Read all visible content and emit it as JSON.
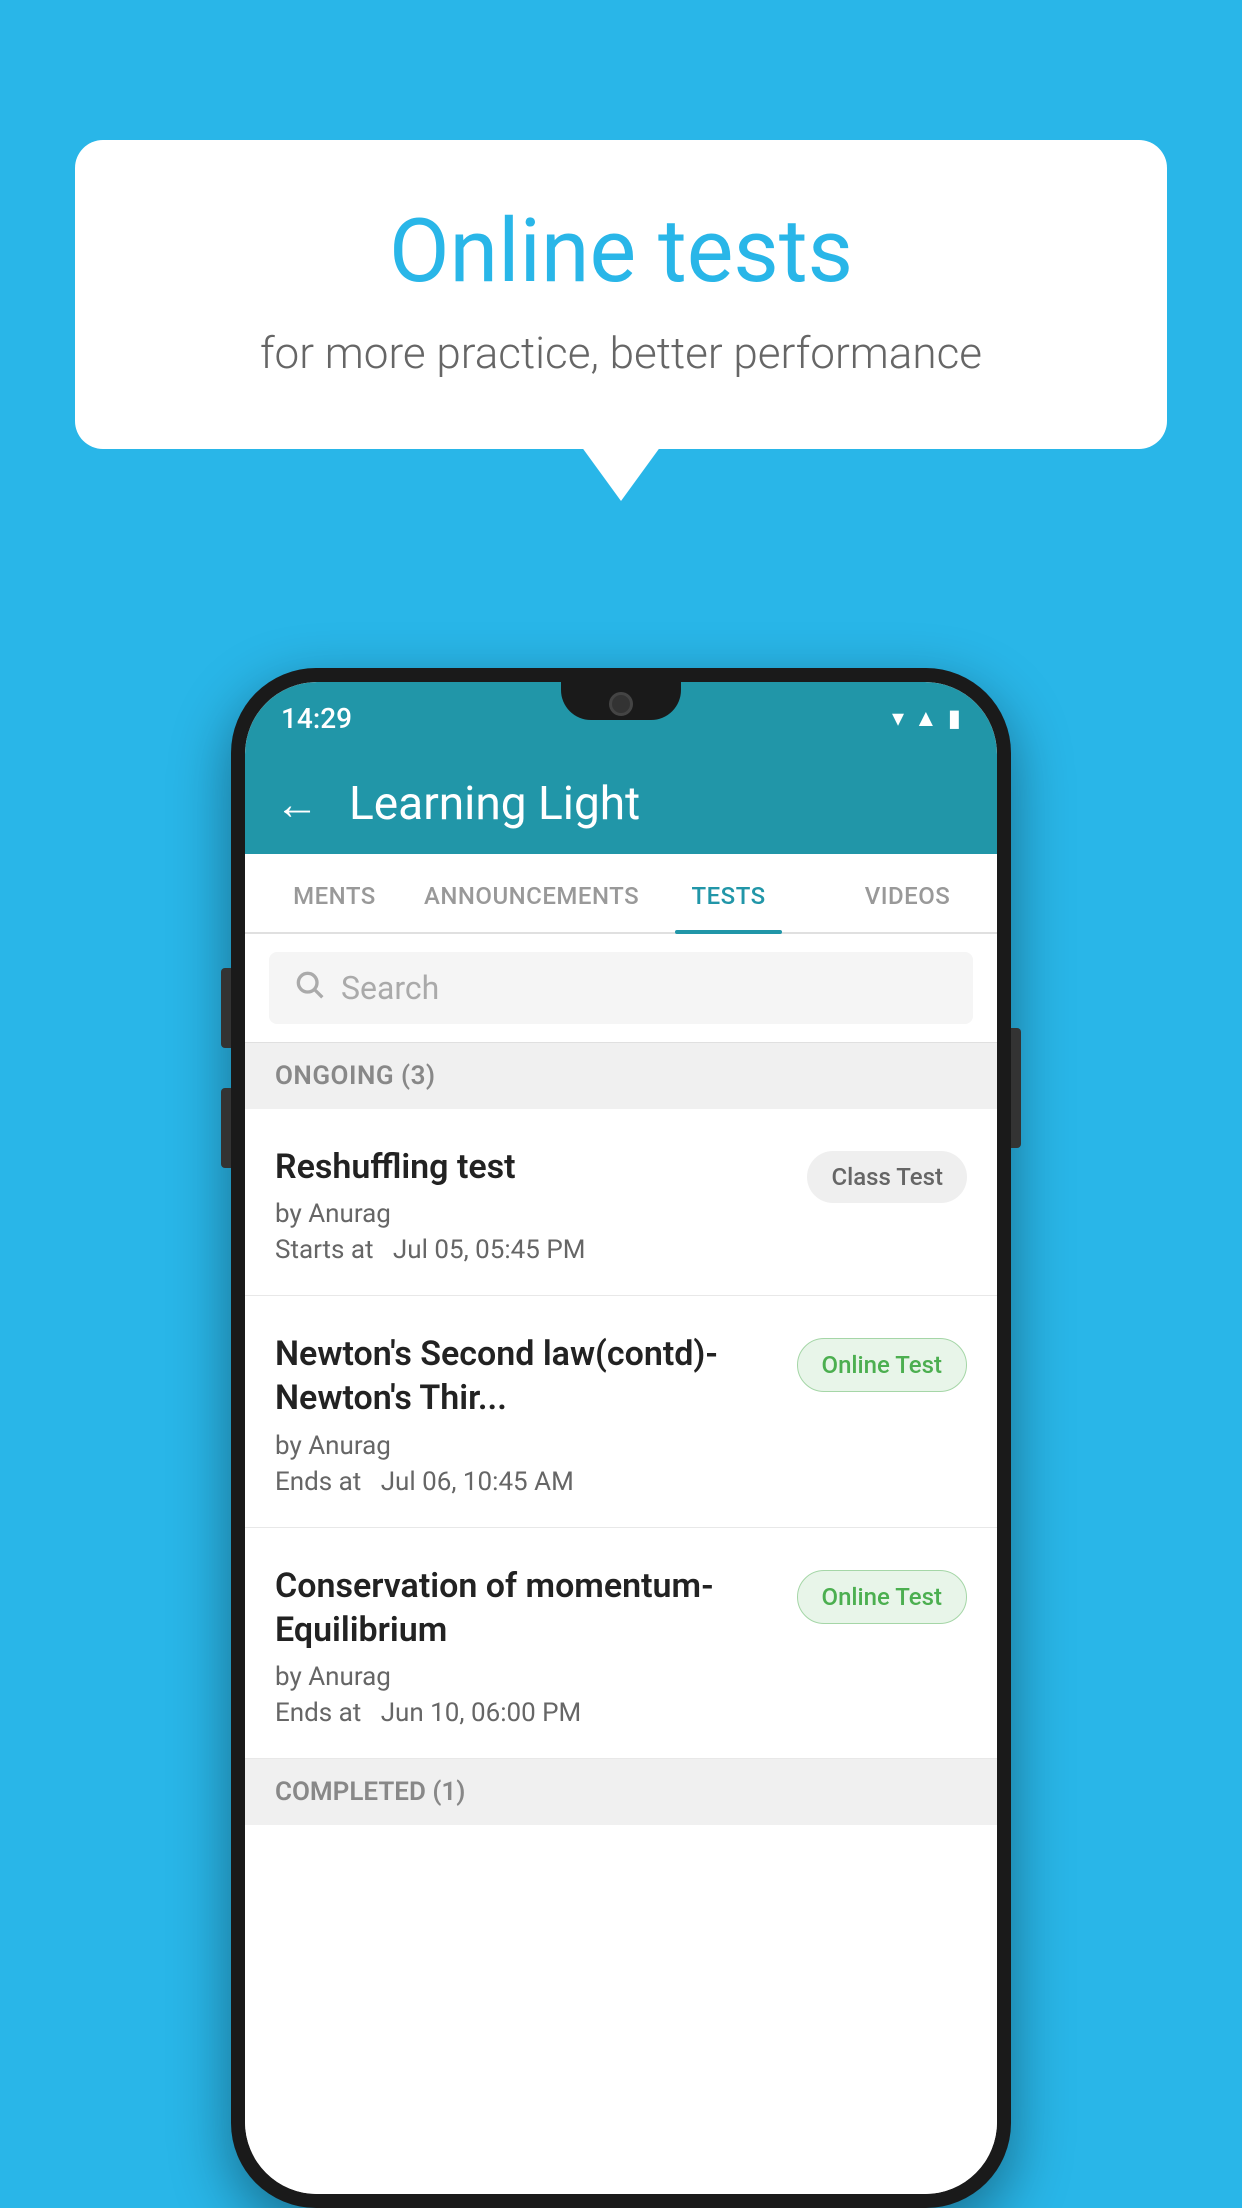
{
  "background": {
    "color": "#29b6e8"
  },
  "speech_bubble": {
    "title": "Online tests",
    "subtitle": "for more practice, better performance"
  },
  "phone": {
    "status_bar": {
      "time": "14:29",
      "icons": [
        "wifi",
        "signal",
        "battery"
      ]
    },
    "app_bar": {
      "back_label": "←",
      "title": "Learning Light"
    },
    "tabs": [
      {
        "label": "MENTS",
        "active": false
      },
      {
        "label": "ANNOUNCEMENTS",
        "active": false
      },
      {
        "label": "TESTS",
        "active": true
      },
      {
        "label": "VIDEOS",
        "active": false
      }
    ],
    "search": {
      "placeholder": "Search",
      "icon": "search"
    },
    "sections": [
      {
        "header": "ONGOING (3)",
        "items": [
          {
            "title": "Reshuffling test",
            "author": "by Anurag",
            "date_label": "Starts at",
            "date": "Jul 05, 05:45 PM",
            "badge": "Class Test",
            "badge_type": "class"
          },
          {
            "title": "Newton's Second law(contd)-Newton's Thir...",
            "author": "by Anurag",
            "date_label": "Ends at",
            "date": "Jul 06, 10:45 AM",
            "badge": "Online Test",
            "badge_type": "online"
          },
          {
            "title": "Conservation of momentum-Equilibrium",
            "author": "by Anurag",
            "date_label": "Ends at",
            "date": "Jun 10, 06:00 PM",
            "badge": "Online Test",
            "badge_type": "online"
          }
        ]
      },
      {
        "header": "COMPLETED (1)",
        "items": []
      }
    ]
  }
}
